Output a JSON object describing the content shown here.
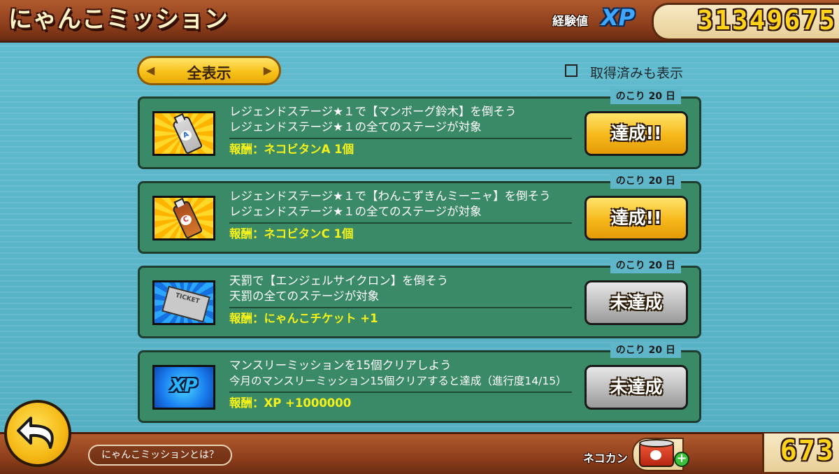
{
  "header": {
    "title": "にゃんこミッション",
    "xp_label": "経験値",
    "xp_word": "XP",
    "xp_value": "31349675"
  },
  "filter": {
    "label": "全表示",
    "left_arrow": "◀",
    "right_arrow": "▶",
    "show_claimed_label": "取得済みも表示",
    "show_claimed_checked": false
  },
  "missions": [
    {
      "icon": "neko-vitan-a-icon",
      "icon_letter": "A",
      "line1": "レジェンドステージ★１で【マンボーグ鈴木】を倒そう",
      "line2": "レジェンドステージ★１の全てのステージが対象",
      "reward": "報酬：ネコビタンA 1個",
      "days_left": "のこり 20 日",
      "status": "達成!!"
    },
    {
      "icon": "neko-vitan-c-icon",
      "icon_letter": "C",
      "line1": "レジェンドステージ★１で【わんこずきんミーニャ】を倒そう",
      "line2": "レジェンドステージ★１の全てのステージが対象",
      "reward": "報酬：ネコビタンC 1個",
      "days_left": "のこり 20 日",
      "status": "達成!!"
    },
    {
      "icon": "nyanko-ticket-icon",
      "icon_letter": "TICKET",
      "line1": "天罰で【エンジェルサイクロン】を倒そう",
      "line2": "天罰の全てのステージが対象",
      "reward": "報酬：にゃんこチケット +1",
      "days_left": "のこり 20 日",
      "status": "未達成"
    },
    {
      "icon": "xp-icon",
      "icon_letter": "XP",
      "line1": "マンスリーミッションを15個クリアしよう",
      "line2": "今月のマンスリーミッション15個クリアすると達成（進行度14/15）",
      "reward": "報酬：XP +1000000",
      "days_left": "のこり 20 日",
      "status": "未達成"
    }
  ],
  "footer": {
    "help_label": "にゃんこミッションとは？",
    "cat_food_label": "ネコカン",
    "cat_food_value": "673",
    "plus": "+"
  },
  "colors": {
    "accent_yellow": "#f6b81a",
    "reward_yellow": "#f4f21a",
    "panel_green": "#3b8a67",
    "header_brown": "#8e3f1c"
  }
}
